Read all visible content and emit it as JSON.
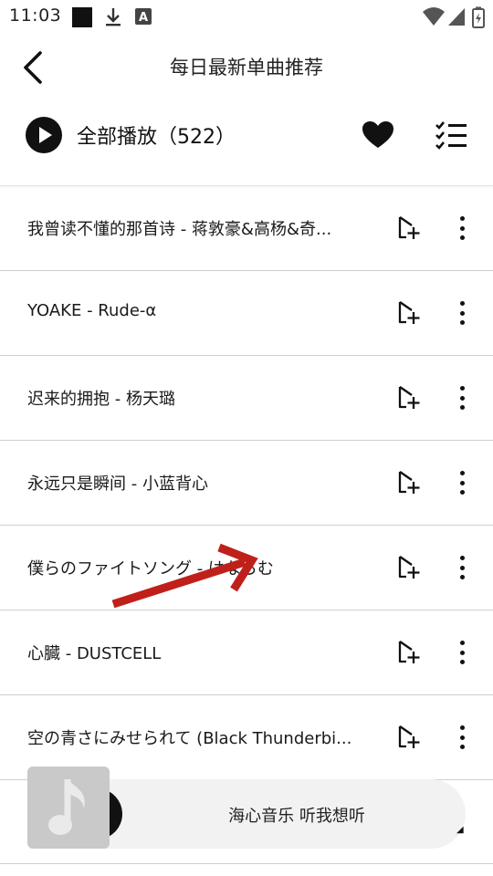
{
  "status_bar": {
    "time": "11:03",
    "icons": [
      "notification-square-icon",
      "download-icon",
      "a-badge-icon",
      "wifi-icon",
      "signal-icon",
      "battery-icon"
    ]
  },
  "header": {
    "back_icon": "chevron-left-icon",
    "title": "每日最新单曲推荐"
  },
  "toolbar": {
    "play_all_label": "全部播放（522）",
    "favorite_icon": "heart-icon",
    "select_icon": "checklist-icon"
  },
  "songs": [
    {
      "title": "我曾读不懂的那首诗 - 蒋敦豪&高杨&奇..."
    },
    {
      "title": "YOAKE - Rude-α"
    },
    {
      "title": "迟来的拥抱 - 杨天璐"
    },
    {
      "title": "永远只是瞬间 - 小蓝背心"
    },
    {
      "title": "僕らのファイトソング - はならむ"
    },
    {
      "title": "心臓 - DUSTCELL"
    },
    {
      "title": "空の青さにみせられて (Black Thunderbi..."
    }
  ],
  "mini_player": {
    "text": "海心音乐 听我想听",
    "cover_icon": "music-note-icon"
  },
  "colors": {
    "accent": "#111111",
    "annotation_arrow": "#c0201a",
    "divider": "#cfcfcf",
    "player_bg": "#f2f2f2",
    "cover_bg": "#c9c9c9"
  }
}
